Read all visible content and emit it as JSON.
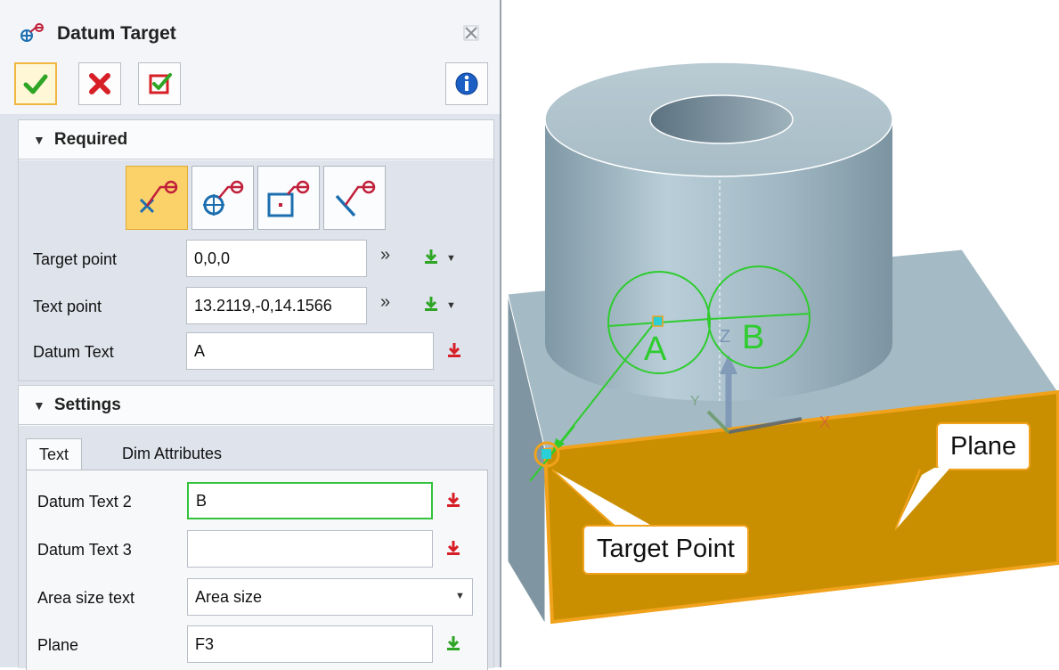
{
  "dialog": {
    "title": "Datum Target",
    "close_icon": "close-icon"
  },
  "toolbar": {
    "ok_icon": "checkmark-icon",
    "cancel_icon": "x-icon",
    "apply_icon": "apply-icon",
    "info_icon": "info-icon"
  },
  "required": {
    "header": "Required",
    "types": [
      "point-target-icon",
      "circle-target-icon",
      "rectangle-target-icon",
      "line-target-icon"
    ],
    "target_point": {
      "label": "Target point",
      "value": "0,0,0"
    },
    "text_point": {
      "label": "Text point",
      "value": "13.2119,-0,14.1566"
    },
    "datum_text": {
      "label": "Datum Text",
      "value": "A"
    }
  },
  "settings": {
    "header": "Settings",
    "tabs": [
      "Text",
      "Dim Attributes"
    ],
    "datum_text_2": {
      "label": "Datum Text 2",
      "value": "B"
    },
    "datum_text_3": {
      "label": "Datum Text 3",
      "value": ""
    },
    "area_size_text": {
      "label": "Area size text",
      "value": "Area size"
    },
    "plane": {
      "label": "Plane",
      "value": "F3"
    }
  },
  "viewport": {
    "datum_label_a": "A",
    "datum_label_b": "B",
    "axis_z": "Z",
    "axis_x": "X",
    "axis_y": "Y",
    "callout_plane": "Plane",
    "callout_target": "Target Point"
  },
  "colors": {
    "model_face": "#a4bac4",
    "selected_face": "#c98f00",
    "highlight": "#f0a21c",
    "annotation": "#2ecc2e",
    "active_type": "#fbd26a"
  }
}
